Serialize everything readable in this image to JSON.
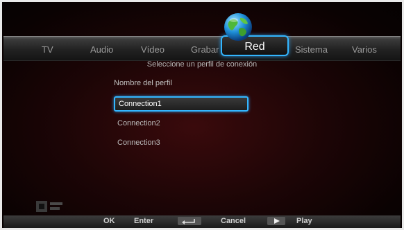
{
  "menu": {
    "tabs": [
      "TV",
      "Audio",
      "Vídeo",
      "Grabar",
      "Red",
      "Sistema",
      "Varios"
    ],
    "active": "Red",
    "active_icon": "globe-icon"
  },
  "page": {
    "subtitle": "Seleccione un perfil de conexión",
    "list_label": "Nombre del perfil"
  },
  "profiles": {
    "items": [
      "Connection1",
      "Connection2",
      "Connection3"
    ],
    "selected": "Connection1"
  },
  "footer": {
    "ok": "OK",
    "enter": "Enter",
    "return_icon": "return-arrow-icon",
    "cancel": "Cancel",
    "play_icon": "play-icon",
    "play": "Play"
  },
  "colors": {
    "highlight": "#33b6ff",
    "background": "#1c0506"
  }
}
